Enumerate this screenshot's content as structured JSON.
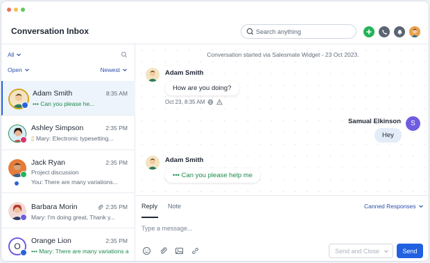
{
  "colors": {
    "accent": "#2160e0",
    "online": "#1b8a4d",
    "header_green": "#25b35a"
  },
  "header": {
    "title": "Conversation Inbox",
    "search_placeholder": "Search anything",
    "icons": [
      "plus-icon",
      "phone-icon",
      "bell-icon",
      "user-avatar"
    ]
  },
  "sidebar": {
    "filter_all": "All",
    "filter_status": "Open",
    "sort": "Newest",
    "conversations": [
      {
        "name": "Adam Smith",
        "time": "8:35 AM",
        "preview": "Can you please he...",
        "channel": "chat"
      },
      {
        "name": "Ashley Simpson",
        "time": "2:35 PM",
        "preview": "Mary: Electronic typesetting...",
        "channel": "instagram"
      },
      {
        "name": "Jack Ryan",
        "time": "2:35 PM",
        "subject": "Project discussion",
        "preview": "You: There are many variations...",
        "channel": "whatsapp"
      },
      {
        "name": "Barbara Morin",
        "time": "2:35 PM",
        "preview": "Mary: I'm doing great, Thank y...",
        "channel": "messenger"
      },
      {
        "name": "Orange Lion",
        "time": "2:35 PM",
        "preview": "Mary: There are many variations avai...",
        "channel": "chat",
        "initial": "O"
      }
    ]
  },
  "thread": {
    "system_message": "Conversation started via Salesmate Widget - 23 Oct 2023.",
    "messages": [
      {
        "sender": "Adam Smith",
        "text": "How are you doing?",
        "meta": "Oct 23, 8:35 AM"
      },
      {
        "sender": "Samual Elkinson",
        "text": "Hey",
        "initial": "S"
      },
      {
        "sender": "Adam Smith",
        "text": "Can you please help me"
      }
    ]
  },
  "composer": {
    "tab_reply": "Reply",
    "tab_note": "Note",
    "canned": "Canned Responses",
    "placeholder": "Type a message...",
    "send_close": "Send and Close",
    "send": "Send"
  }
}
